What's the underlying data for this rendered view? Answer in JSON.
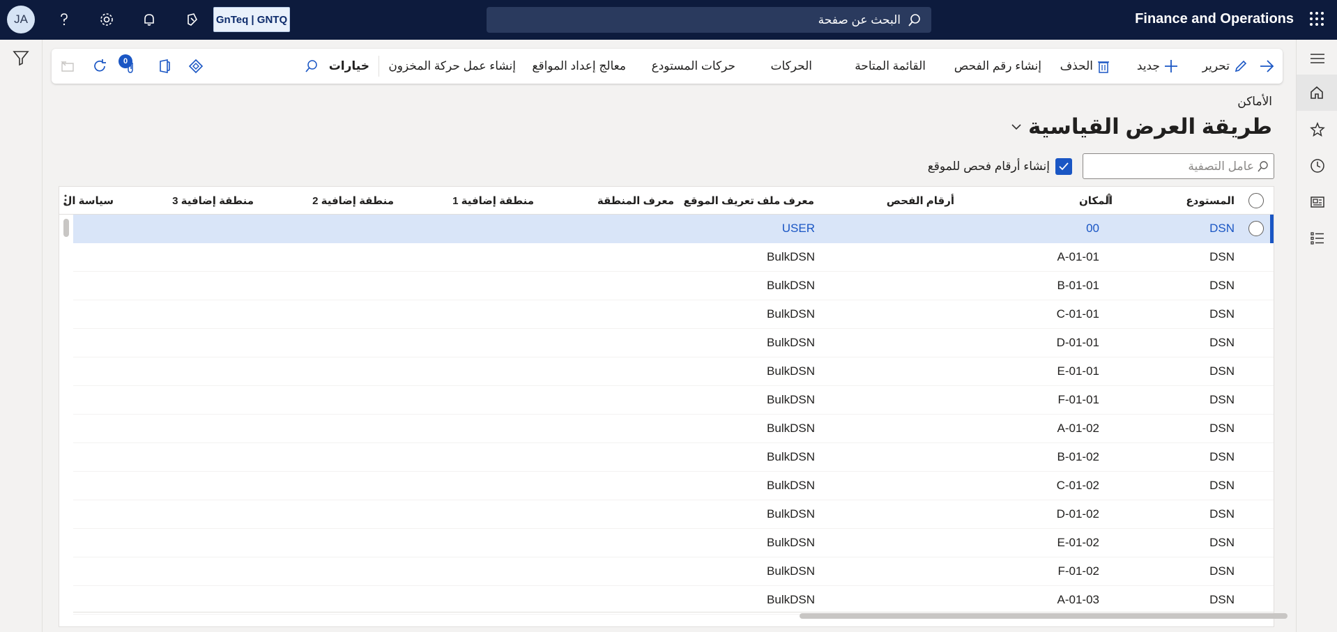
{
  "topbar": {
    "avatar_initials": "JA",
    "company": "GnTeq | GNTQ",
    "search_placeholder": "البحث عن صفحة",
    "app_title": "Finance and Operations",
    "icons": [
      "help-icon",
      "settings-icon",
      "notifications-icon",
      "copilot-icon",
      "waffle-icon"
    ]
  },
  "action_pane": {
    "edit": "تحرير",
    "new": "جديد",
    "delete": "الحذف",
    "create_check_number": "إنشاء رقم الفحص",
    "onhand_list": "القائمة المتاحة",
    "transactions": "الحركات",
    "warehouse_transactions": "حركات المستودع",
    "location_setup_wizard": "معالج إعداد المواقع",
    "create_inventory_movement_work": "إنشاء عمل حركة المخزون",
    "options": "خيارات",
    "attachments_count": "0"
  },
  "page": {
    "breadcrumb": "الأماكن",
    "title": "طريقة العرض القياسية"
  },
  "filter": {
    "placeholder": "عامل التصفية",
    "checkbox_label": "إنشاء أرقام فحص للموقع",
    "checkbox_checked": true
  },
  "grid": {
    "columns": {
      "warehouse": "المستودع",
      "location": "المكان",
      "check_digits": "أرقام الفحص",
      "location_profile": "معرف ملف تعريف الموقع",
      "zone": "معرف المنطقة",
      "extra_zone_1": "منطقة إضافية 1",
      "extra_zone_2": "منطقة إضافية 2",
      "extra_zone_3": "منطقة إضافية 3",
      "policy": "سياسة ال"
    },
    "rows": [
      {
        "warehouse": "DSN",
        "location": "00",
        "profile": "USER",
        "selected": true
      },
      {
        "warehouse": "DSN",
        "location": "A-01-01",
        "profile": "BulkDSN"
      },
      {
        "warehouse": "DSN",
        "location": "B-01-01",
        "profile": "BulkDSN"
      },
      {
        "warehouse": "DSN",
        "location": "C-01-01",
        "profile": "BulkDSN"
      },
      {
        "warehouse": "DSN",
        "location": "D-01-01",
        "profile": "BulkDSN"
      },
      {
        "warehouse": "DSN",
        "location": "E-01-01",
        "profile": "BulkDSN"
      },
      {
        "warehouse": "DSN",
        "location": "F-01-01",
        "profile": "BulkDSN"
      },
      {
        "warehouse": "DSN",
        "location": "A-01-02",
        "profile": "BulkDSN"
      },
      {
        "warehouse": "DSN",
        "location": "B-01-02",
        "profile": "BulkDSN"
      },
      {
        "warehouse": "DSN",
        "location": "C-01-02",
        "profile": "BulkDSN"
      },
      {
        "warehouse": "DSN",
        "location": "D-01-02",
        "profile": "BulkDSN"
      },
      {
        "warehouse": "DSN",
        "location": "E-01-02",
        "profile": "BulkDSN"
      },
      {
        "warehouse": "DSN",
        "location": "F-01-02",
        "profile": "BulkDSN"
      },
      {
        "warehouse": "DSN",
        "location": "A-01-03",
        "profile": "BulkDSN"
      }
    ]
  }
}
